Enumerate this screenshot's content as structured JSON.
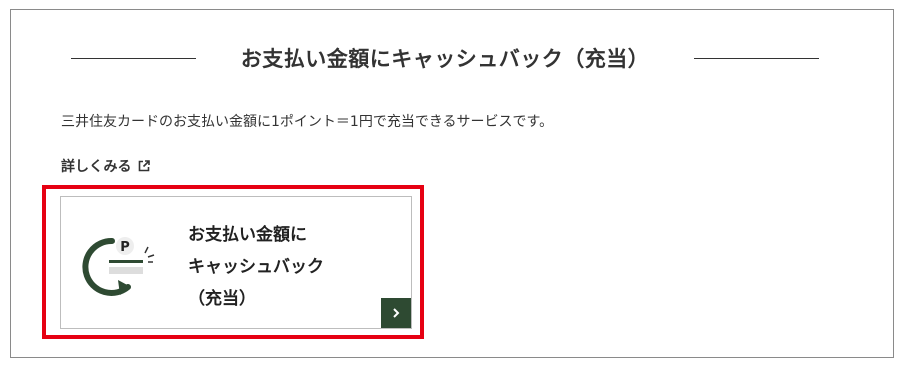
{
  "section": {
    "title": "お支払い金額にキャッシュバック（充当）",
    "description": "三井住友カードのお支払い金額に1ポイント＝1円で充当できるサービスです。",
    "more_link_label": "詳しくみる"
  },
  "card": {
    "title_lines": [
      "お支払い金額に",
      "キャッシュバック",
      "（充当）"
    ],
    "icon": "points-cashback-icon",
    "icon_letter": "P",
    "arrow_icon": "chevron-right-icon"
  },
  "colors": {
    "accent_green": "#2e4a32",
    "highlight_red": "#e60012",
    "text": "#333333"
  }
}
